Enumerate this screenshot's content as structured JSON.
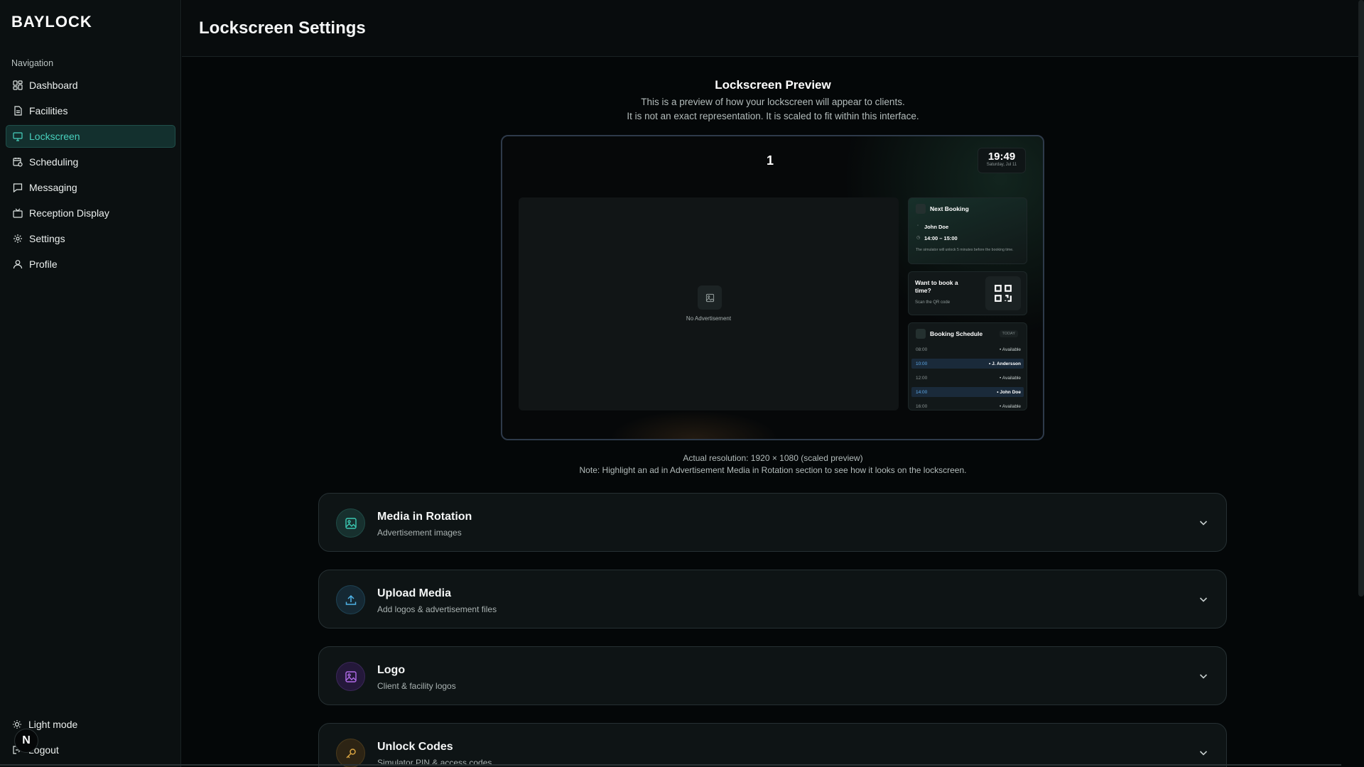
{
  "brand": "BAYLOCK",
  "header": {
    "title": "Lockscreen Settings"
  },
  "sidebar": {
    "heading": "Navigation",
    "items": [
      {
        "label": "Dashboard",
        "icon": "dashboard-icon"
      },
      {
        "label": "Facilities",
        "icon": "file-icon"
      },
      {
        "label": "Lockscreen",
        "icon": "monitor-icon",
        "active": true
      },
      {
        "label": "Scheduling",
        "icon": "calendar-clock-icon"
      },
      {
        "label": "Messaging",
        "icon": "message-icon"
      },
      {
        "label": "Reception Display",
        "icon": "tv-icon"
      },
      {
        "label": "Settings",
        "icon": "gear-icon"
      },
      {
        "label": "Profile",
        "icon": "user-icon"
      }
    ],
    "light_mode": "Light mode",
    "logout": "Logout",
    "avatar_letter": "N"
  },
  "preview": {
    "title": "Lockscreen Preview",
    "subtitle_1": "This is a preview of how your lockscreen will appear to clients.",
    "subtitle_2": "It is not an exact representation. It is scaled to fit within this interface.",
    "screen_number": "1",
    "clock_time": "19:49",
    "clock_date": "Saturday, Jul 11",
    "ad_placeholder": "No Advertisement",
    "next_booking": {
      "title": "Next Booking",
      "name": "John Doe",
      "time": "14:00 – 15:00",
      "note": "The simulator will unlock 5 minutes before the booking time."
    },
    "qr_card": {
      "title": "Want to book a time?",
      "subtitle": "Scan the QR code"
    },
    "schedule": {
      "title": "Booking Schedule",
      "badge": "TODAY",
      "rows": [
        {
          "time": "08:00",
          "who": "Available",
          "booked": false
        },
        {
          "time": "10:00",
          "who": "J. Andersson",
          "booked": true
        },
        {
          "time": "12:00",
          "who": "Available",
          "booked": false
        },
        {
          "time": "14:00",
          "who": "John Doe",
          "booked": true
        },
        {
          "time": "16:00",
          "who": "Available",
          "booked": false
        }
      ]
    },
    "resolution_note": "Actual resolution: 1920 × 1080 (scaled preview)",
    "highlight_note": "Note: Highlight an ad in Advertisement Media in Rotation section to see how it looks on the lockscreen."
  },
  "sections": [
    {
      "title": "Media in Rotation",
      "subtitle": "Advertisement images",
      "icon": "image-icon",
      "color": "#3cc9b3"
    },
    {
      "title": "Upload Media",
      "subtitle": "Add logos & advertisement files",
      "icon": "upload-icon",
      "color": "#4fb3e8"
    },
    {
      "title": "Logo",
      "subtitle": "Client & facility logos",
      "icon": "logo-image-icon",
      "color": "#b06be8"
    },
    {
      "title": "Unlock Codes",
      "subtitle": "Simulator PIN & access codes",
      "icon": "key-icon",
      "color": "#d9a441"
    }
  ]
}
